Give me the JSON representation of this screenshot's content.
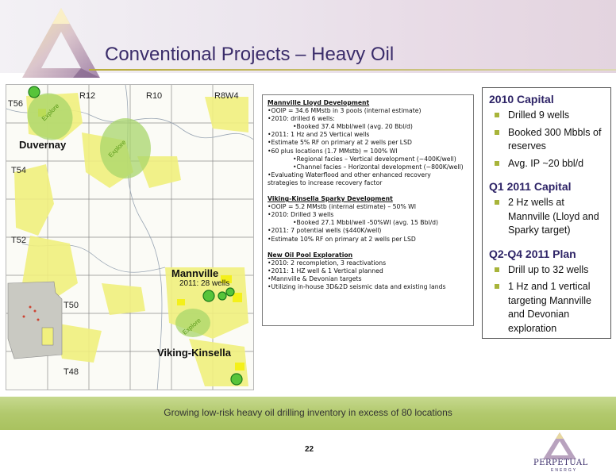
{
  "header": {
    "title": "Conventional Projects – Heavy Oil"
  },
  "map": {
    "labels": {
      "t56": "T56",
      "t54": "T54",
      "t52": "T52",
      "t50": "T50",
      "t48": "T48",
      "r12": "R12",
      "r10": "R10",
      "r8w4": "R8W4",
      "duvernay": "Duvernay",
      "mannville": "Mannville",
      "mannville_wells": "2011: 28 wells",
      "viking_kinsella": "Viking-Kinsella",
      "explore": "Explore"
    },
    "colors": {
      "yellow": "#f1f07e",
      "bright_yellow": "#f4f01a",
      "green": "#a8d66b",
      "green_circle": "#2a9a2a"
    }
  },
  "textbox": {
    "mannville_lloyd": {
      "heading": "Mannville Lloyd Development",
      "lines": [
        {
          "level": 1,
          "text": "OOIP = 34.6 MMstb in 3 pools (internal estimate)"
        },
        {
          "level": 1,
          "text": "2010: drilled 6 wells:"
        },
        {
          "level": 2,
          "text": "Booked 37.4 Mbbl/well (avg. 20 Bbl/d)"
        },
        {
          "level": 1,
          "text": "2011: 1 Hz and 25 Vertical wells"
        },
        {
          "level": 1,
          "text": "Estimate 5% RF on primary at 2 wells per LSD"
        },
        {
          "level": 1,
          "text": "60 plus locations (1.7 MMstb) = 100% WI"
        },
        {
          "level": 2,
          "text": "Regional facies – Vertical development (~400K/well)"
        },
        {
          "level": 2,
          "text": "Channel facies – Horizontal development (~800K/well)"
        },
        {
          "level": 1,
          "text": "Evaluating Waterflood and other enhanced recovery"
        },
        {
          "level": 0,
          "text": "strategies to increase recovery factor"
        }
      ]
    },
    "viking_kinsella": {
      "heading": "Viking-Kinsella Sparky Development",
      "lines": [
        {
          "level": 1,
          "text": "OOIP = 5.2 MMstb (internal estimate) – 50% WI"
        },
        {
          "level": 1,
          "text": "2010: Drilled 3 wells"
        },
        {
          "level": 2,
          "text": "Booked 27.1 Mbbl/well -50%WI (avg. 15 Bbl/d)"
        },
        {
          "level": 1,
          "text": "2011: 7 potential wells ($440K/well)"
        },
        {
          "level": 1,
          "text": "Estimate 10% RF on primary at 2 wells per LSD"
        }
      ]
    },
    "new_oil_pool": {
      "heading": "New Oil Pool Exploration",
      "lines": [
        {
          "level": 1,
          "text": "2010: 2 recompletion, 3 reactivations"
        },
        {
          "level": 1,
          "text": "2011: 1 HZ well & 1 Vertical planned"
        },
        {
          "level": 1,
          "text": "Mannville & Devonian targets"
        },
        {
          "level": 1,
          "text": "Utilizing in-house 3D&2D seismic data and existing lands"
        }
      ]
    }
  },
  "panel": {
    "cap2010": {
      "heading": "2010 Capital",
      "items": [
        "Drilled 9 wells",
        "Booked 300 Mbbls of reserves",
        "Avg. IP ~20 bbl/d"
      ]
    },
    "q1_2011": {
      "heading": "Q1 2011 Capital",
      "items": [
        "2 Hz wells at Mannville (Lloyd and Sparky target)"
      ]
    },
    "q2q4_2011": {
      "heading": "Q2-Q4 2011 Plan",
      "items": [
        "Drill up to 32 wells",
        "1 Hz and 1 vertical targeting Mannville and Devonian exploration"
      ]
    }
  },
  "footer": {
    "tagline": "Growing low-risk heavy oil drilling inventory in excess of 80 locations",
    "page_number": "22",
    "brand_name": "Perpetual",
    "brand_sub": "ENERGY"
  }
}
